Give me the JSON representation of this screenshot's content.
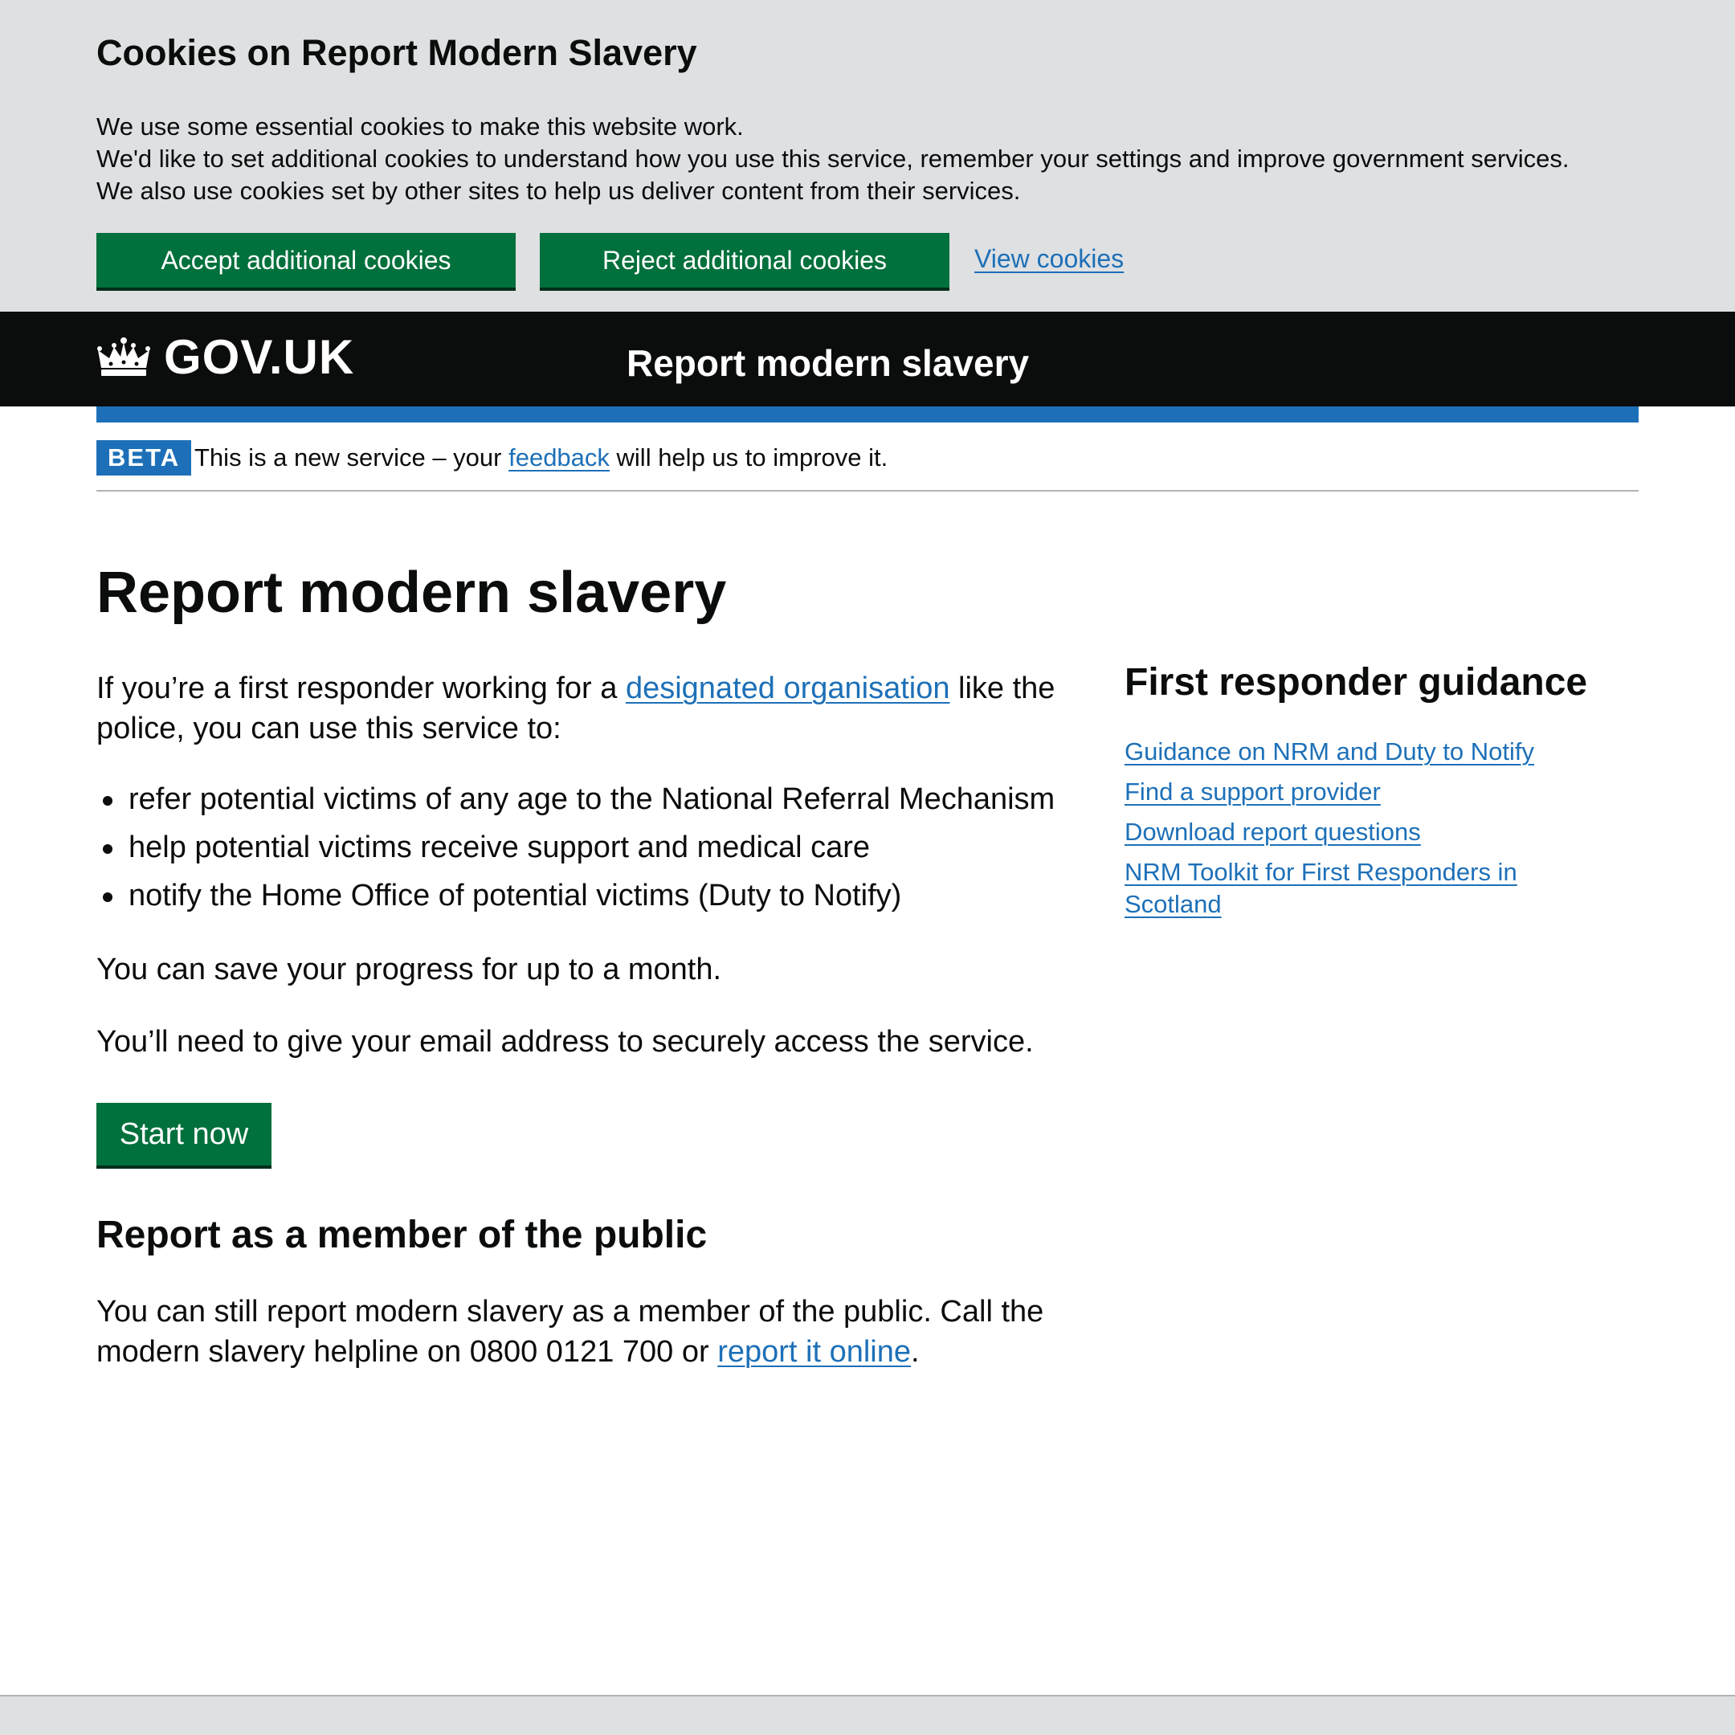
{
  "cookie_banner": {
    "title": "Cookies on Report Modern Slavery",
    "lines": [
      "We use some essential cookies to make this website work.",
      "We'd like to set additional cookies to understand how you use this service, remember your settings and improve government services.",
      "We also use cookies set by other sites to help us deliver content from their services."
    ],
    "accept_label": "Accept additional cookies",
    "reject_label": "Reject additional cookies",
    "view_label": "View cookies"
  },
  "header": {
    "logo_text": "GOV.UK",
    "service_name": "Report modern slavery"
  },
  "phase_banner": {
    "tag": "BETA",
    "text_before": "This is a new service – your ",
    "link": "feedback",
    "text_after": " will help us to improve it."
  },
  "main": {
    "title": "Report modern slavery",
    "intro_before": "If you’re a first responder working for a ",
    "intro_link": "designated organisation",
    "intro_after": " like the police, you can use this service to:",
    "list": [
      "refer potential victims of any age to the National Referral Mechanism",
      "help potential victims receive support and medical care",
      "notify the Home Office of potential victims (Duty to Notify)"
    ],
    "save_text": "You can save your progress for up to a month.",
    "email_text": "You’ll need to give your email address to securely access the service.",
    "start_label": "Start now",
    "public_heading": "Report as a member of the public",
    "public_before": "You can still report modern slavery as a member of the public. Call the modern slavery helpline on 0800 0121 700 or ",
    "public_link": "report it online",
    "public_after": "."
  },
  "sidebar": {
    "heading": "First responder guidance",
    "links": [
      "Guidance on NRM and Duty to Notify",
      "Find a support provider",
      "Download report questions",
      "NRM Toolkit for First Responders in Scotland"
    ]
  },
  "colors": {
    "banner_bg": "#dee0e2",
    "header_bg": "#0b0c0c",
    "brand_blue": "#1d70b8",
    "button_green": "#00703c",
    "link": "#1d70b8",
    "text": "#0b0c0c"
  },
  "icons": {
    "logo": "crown-icon"
  }
}
